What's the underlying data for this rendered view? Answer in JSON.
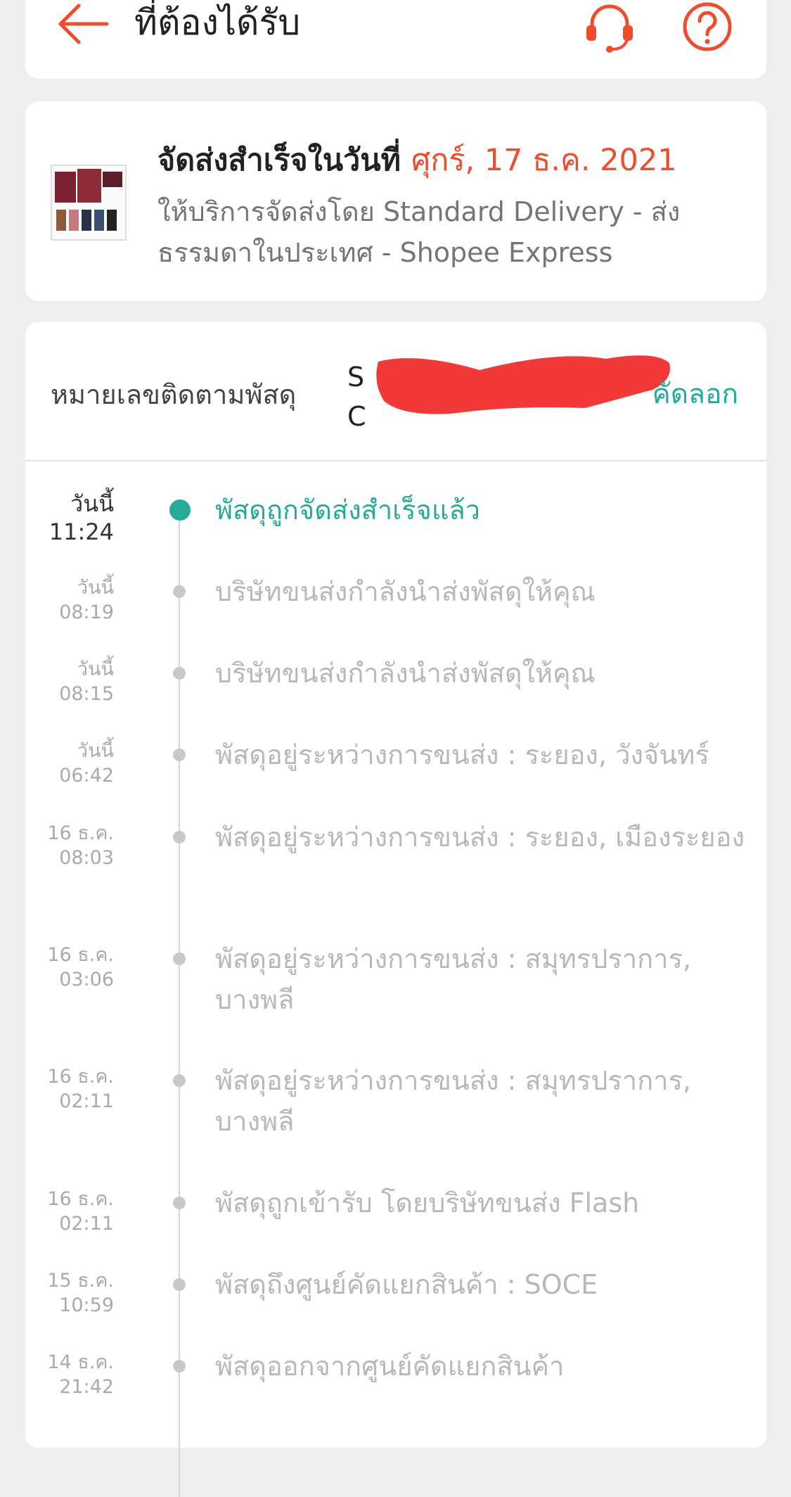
{
  "header": {
    "title": "ที่ต้องได้รับ",
    "back_icon": "arrow-left-icon",
    "support_icon": "headset-icon",
    "help_icon": "question-circle-icon",
    "accent_color": "#ee4d2d"
  },
  "delivery": {
    "prefix": "จัดส่งสำเร็จในวันที่ ",
    "date": "ศุกร์, 17 ธ.ค. 2021",
    "service": "ให้บริการจัดส่งโดย Standard Delivery - ส่งธรรมดาในประเทศ - Shopee Express"
  },
  "tracking": {
    "label": "หมายเลขติดตามพัสดุ",
    "number_line1": "S",
    "number_line2": "C",
    "copy_label": "คัดลอก",
    "copy_color": "#26aa99"
  },
  "events": [
    {
      "date": "วันนี้",
      "time": "11:24",
      "text": "พัสดุถูกจัดส่งสำเร็จแล้ว"
    },
    {
      "date": "วันนี้",
      "time": "08:19",
      "text": "บริษัทขนส่งกำลังนำส่งพัสดุให้คุณ"
    },
    {
      "date": "วันนี้",
      "time": "08:15",
      "text": "บริษัทขนส่งกำลังนำส่งพัสดุให้คุณ"
    },
    {
      "date": "วันนี้",
      "time": "06:42",
      "text": "พัสดุอยู่ระหว่างการขนส่ง : ระยอง, วังจันทร์"
    },
    {
      "date": "16 ธ.ค.",
      "time": "08:03",
      "text": "พัสดุอยู่ระหว่างการขนส่ง : ระยอง, เมืองระยอง"
    },
    {
      "date": "16 ธ.ค.",
      "time": "03:06",
      "text": "พัสดุอยู่ระหว่างการขนส่ง : สมุทรปราการ, บางพลี"
    },
    {
      "date": "16 ธ.ค.",
      "time": "02:11",
      "text": "พัสดุอยู่ระหว่างการขนส่ง : สมุทรปราการ, บางพลี"
    },
    {
      "date": "16 ธ.ค.",
      "time": "02:11",
      "text": "พัสดุถูกเข้ารับ โดยบริษัทขนส่ง Flash"
    },
    {
      "date": "15 ธ.ค.",
      "time": "10:59",
      "text": "พัสดุถึงศูนย์คัดแยกสินค้า : SOCE"
    },
    {
      "date": "14 ธ.ค.",
      "time": "21:42",
      "text": "พัสดุออกจากศูนย์คัดแยกสินค้า"
    }
  ]
}
